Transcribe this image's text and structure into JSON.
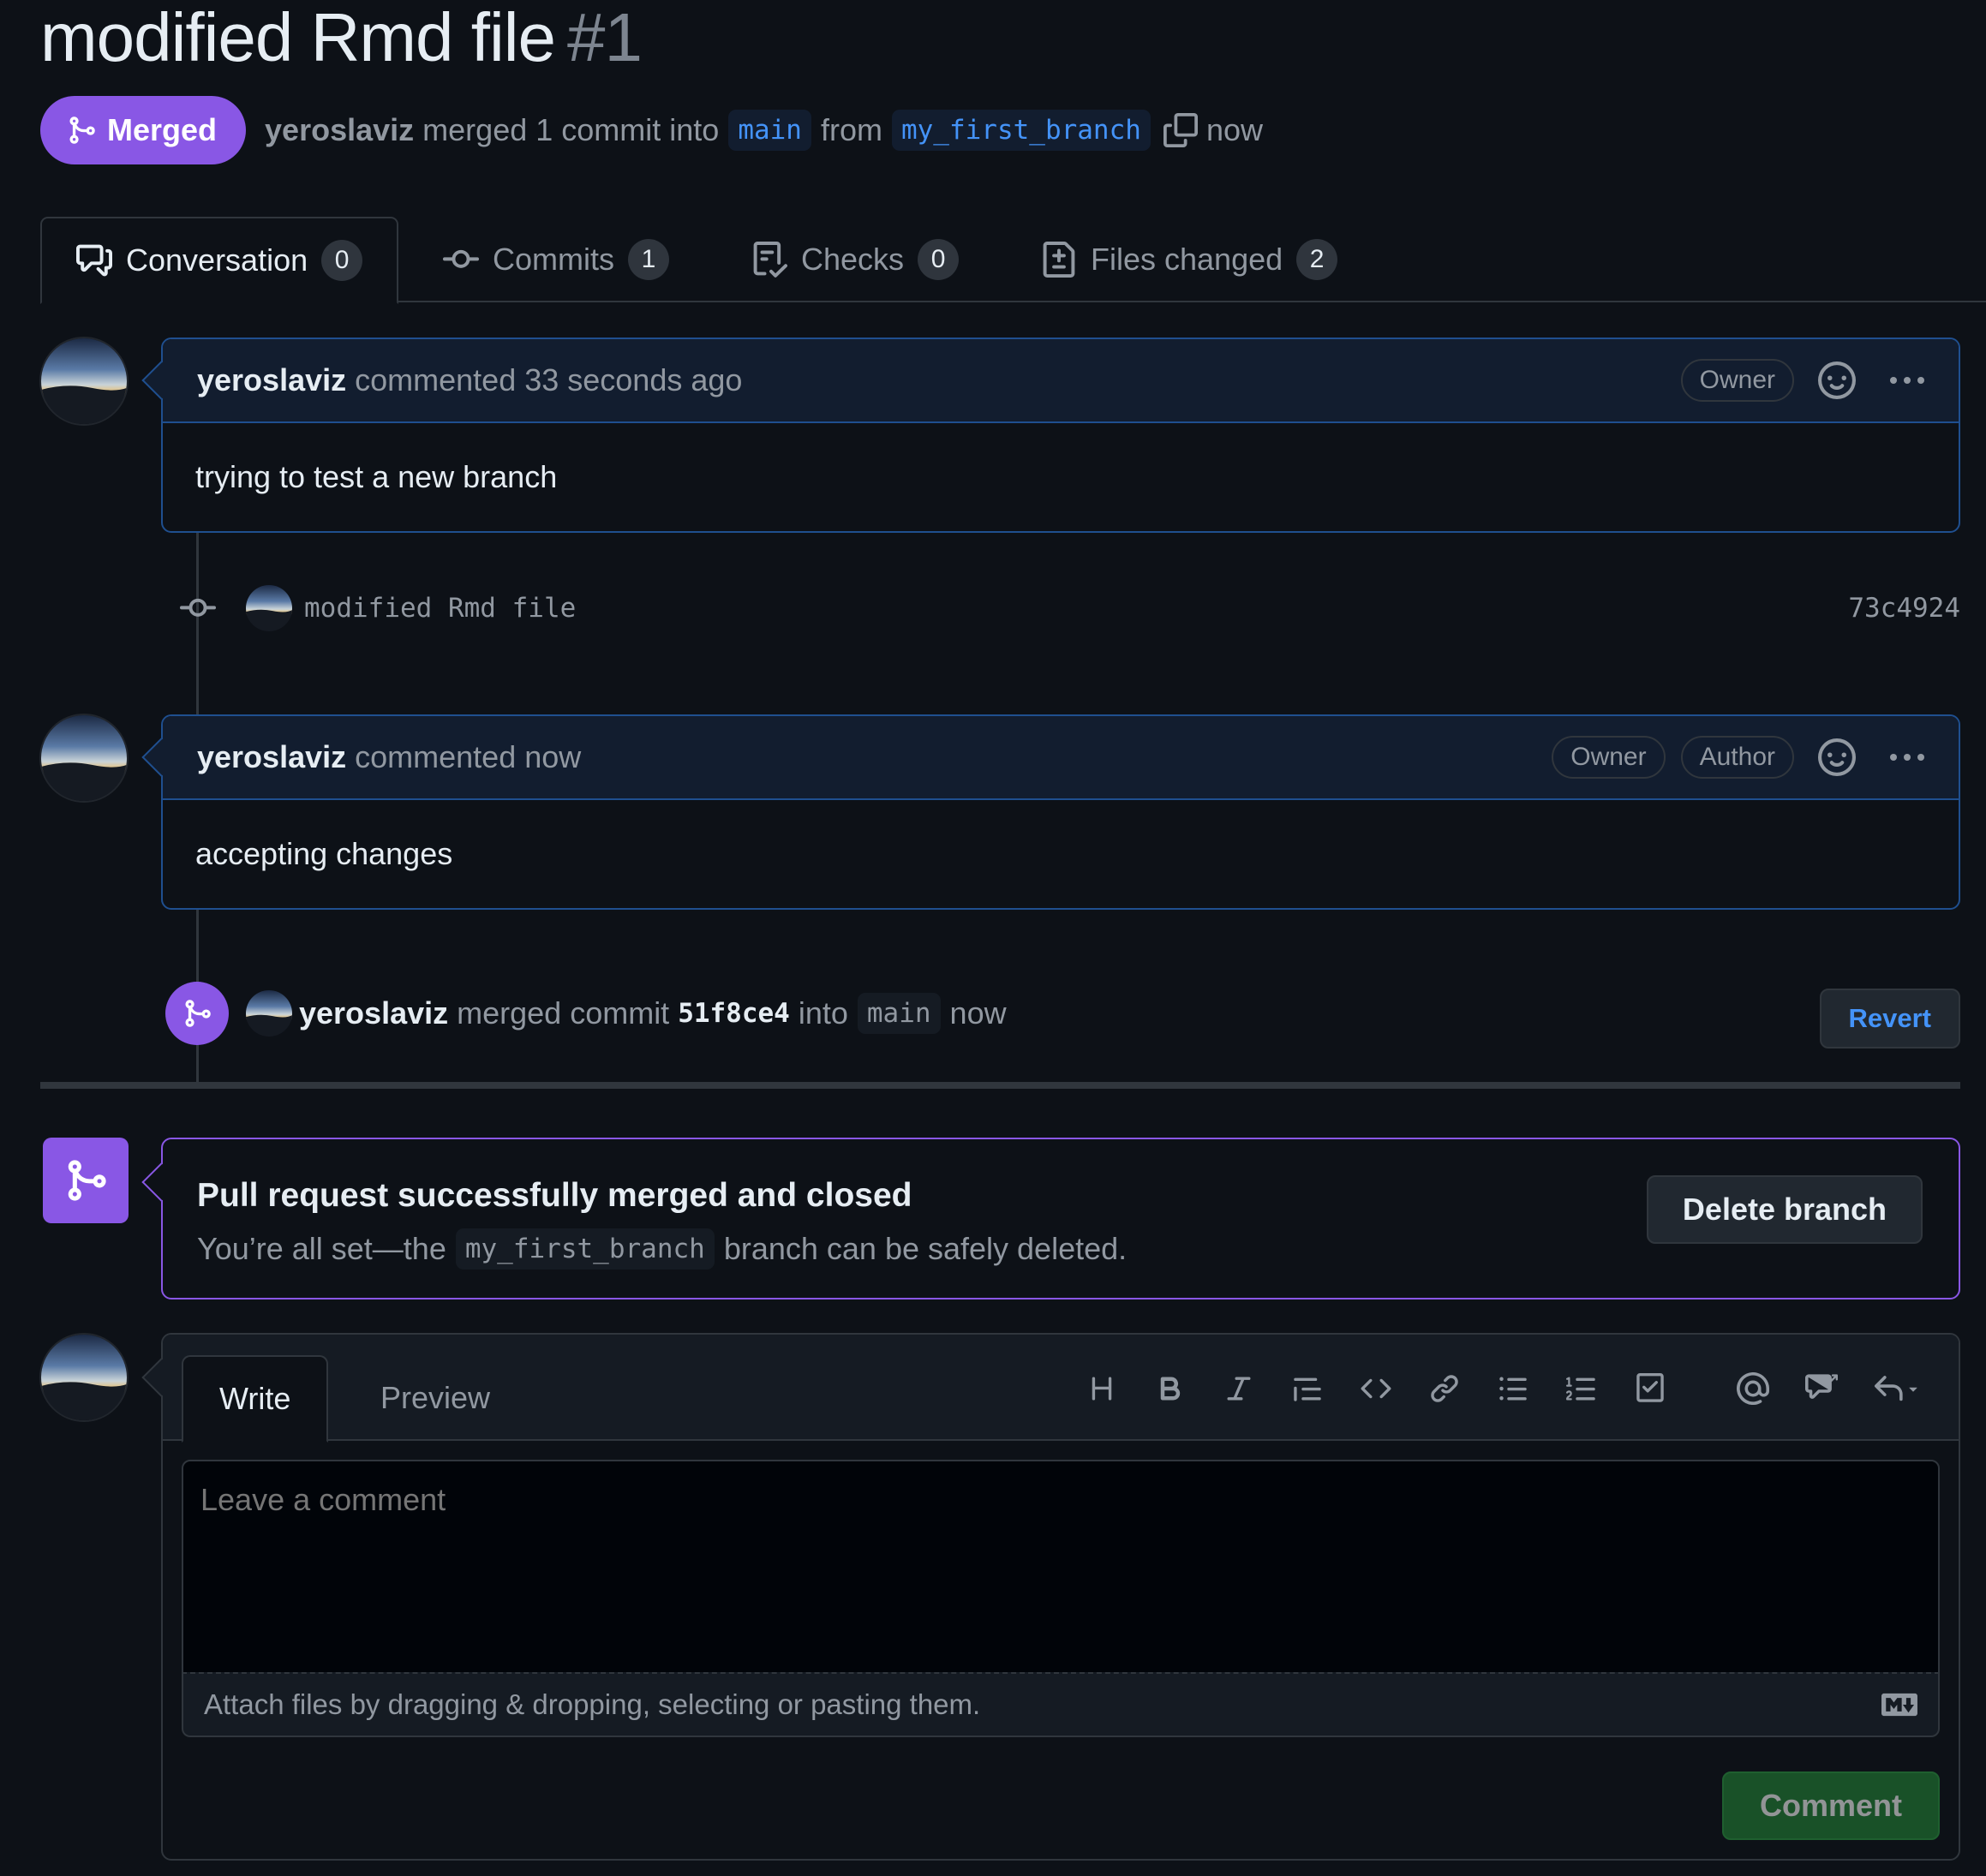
{
  "pr": {
    "title": "modified Rmd file",
    "number": "#1",
    "state": "Merged",
    "author": "yeroslaviz",
    "merged_text": "merged 1 commit into",
    "base_branch": "main",
    "from_text": "from",
    "head_branch": "my_first_branch",
    "time": "now"
  },
  "tabs": [
    {
      "label": "Conversation",
      "count": "0",
      "icon": "comment-discussion-icon"
    },
    {
      "label": "Commits",
      "count": "1",
      "icon": "git-commit-icon"
    },
    {
      "label": "Checks",
      "count": "0",
      "icon": "checklist-icon"
    },
    {
      "label": "Files changed",
      "count": "2",
      "icon": "file-diff-icon"
    }
  ],
  "comments": [
    {
      "author": "yeroslaviz",
      "meta": "commented 33 seconds ago",
      "badges": [
        "Owner"
      ],
      "body": "trying to test a new branch"
    },
    {
      "author": "yeroslaviz",
      "meta": "commented now",
      "badges": [
        "Owner",
        "Author"
      ],
      "body": "accepting changes"
    }
  ],
  "commit": {
    "message": "modified Rmd file",
    "sha": "73c4924"
  },
  "merge_event": {
    "author": "yeroslaviz",
    "text1": "merged commit",
    "sha": "51f8ce4",
    "text2": "into",
    "branch": "main",
    "time": "now",
    "revert_label": "Revert"
  },
  "merged_box": {
    "title": "Pull request successfully merged and closed",
    "sub_prefix": "You’re all set—the",
    "branch": "my_first_branch",
    "sub_suffix": "branch can be safely deleted.",
    "delete_label": "Delete branch"
  },
  "editor": {
    "write_tab": "Write",
    "preview_tab": "Preview",
    "placeholder": "Leave a comment",
    "attach_text": "Attach files by dragging & dropping, selecting or pasting them.",
    "comment_label": "Comment",
    "toolbar": [
      "heading-icon",
      "bold-icon",
      "italic-icon",
      "quote-icon",
      "code-icon",
      "link-icon",
      "bulleted-list-icon",
      "numbered-list-icon",
      "task-list-icon",
      "mention-icon",
      "cross-reference-icon",
      "saved-replies-icon"
    ]
  },
  "colors": {
    "background": "#0d1117",
    "merged_purple": "#8957e5",
    "link_blue": "#4493f8",
    "comment_green": "#238636"
  }
}
